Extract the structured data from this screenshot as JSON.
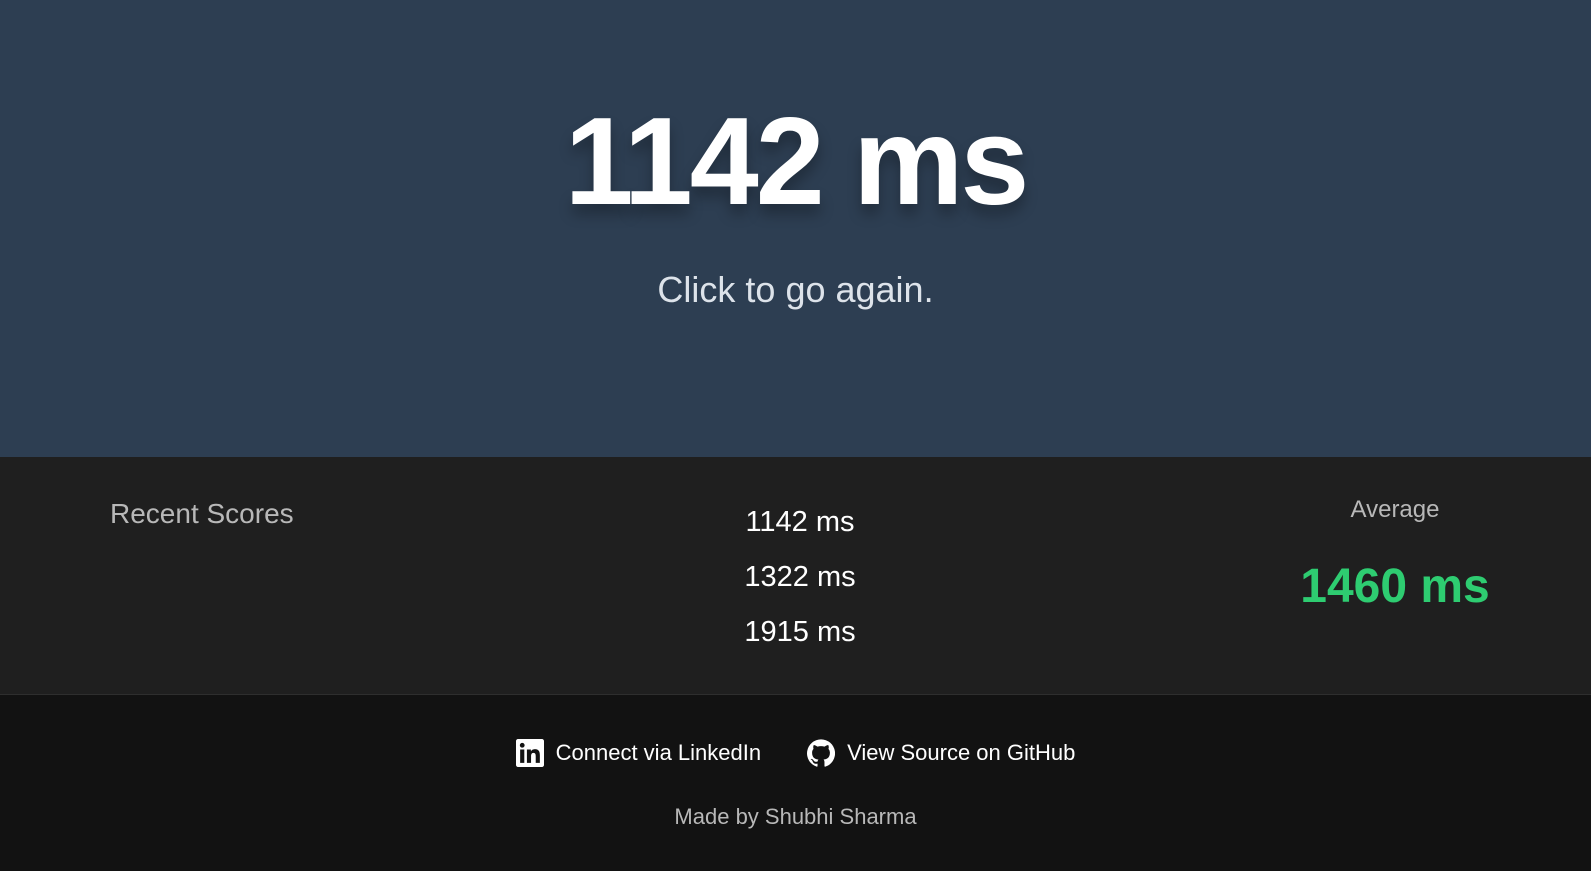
{
  "hero": {
    "time": "1142 ms",
    "subtitle": "Click to go again."
  },
  "scores": {
    "title": "Recent Scores",
    "items": [
      "1142 ms",
      "1322 ms",
      "1915 ms"
    ],
    "average_label": "Average",
    "average_value": "1460 ms"
  },
  "footer": {
    "linkedin_label": "Connect via LinkedIn",
    "linkedin_icon": "linkedin-icon",
    "github_label": "View Source on GitHub",
    "github_icon": "github-icon",
    "made_by": "Made by Shubhi Sharma"
  },
  "colors": {
    "hero_bg": "#2d3e52",
    "scores_bg": "#1f1f1f",
    "footer_bg": "#121212",
    "average_accent": "#2ecc71"
  }
}
